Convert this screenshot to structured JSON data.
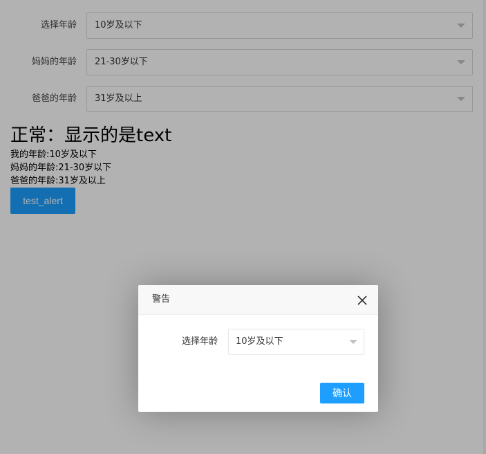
{
  "form": {
    "rows": [
      {
        "label": "选择年龄",
        "value": "10岁及以下"
      },
      {
        "label": "妈妈的年龄",
        "value": "21-30岁以下"
      },
      {
        "label": "爸爸的年龄",
        "value": "31岁及以上"
      }
    ]
  },
  "result": {
    "headline": "正常：显示的是text",
    "lines": [
      "我的年龄:10岁及以下",
      "妈妈的年龄:21-30岁以下",
      "爸爸的年龄:31岁及以上"
    ]
  },
  "test_button": {
    "label": "test_alert"
  },
  "dialog": {
    "title": "警告",
    "field_label": "选择年龄",
    "field_value": "10岁及以下",
    "confirm_label": "确认"
  },
  "colors": {
    "primary": "#1e9fff",
    "overlay": "rgba(0,0,0,0.3)"
  },
  "icons": {
    "dropdown": "triangle-down-icon",
    "close": "close-icon"
  }
}
